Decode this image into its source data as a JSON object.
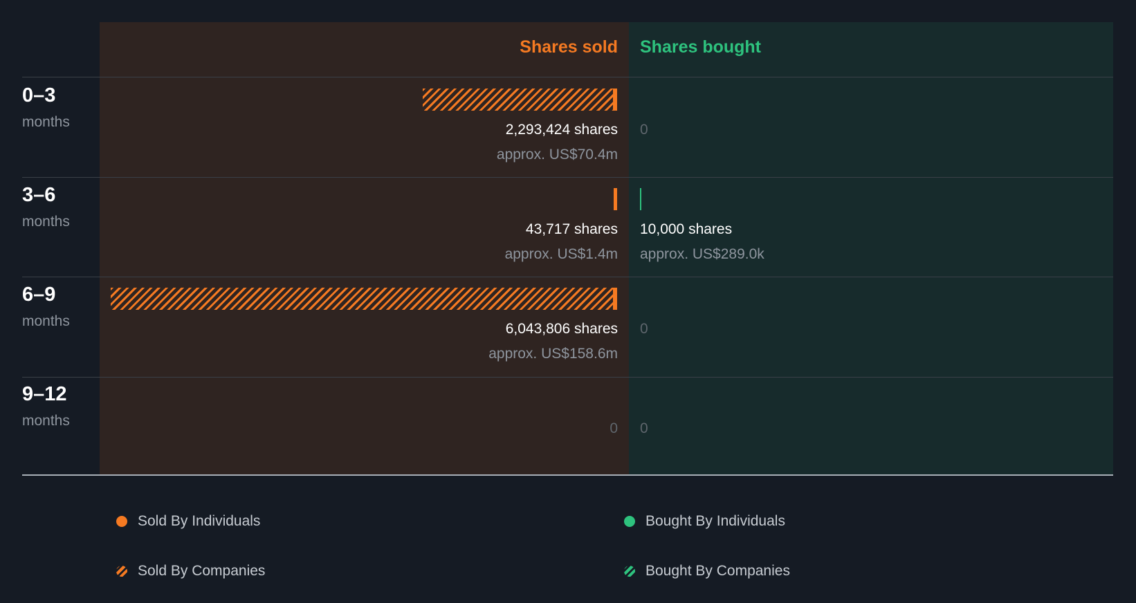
{
  "chart_data": {
    "type": "bar",
    "headers": {
      "sold": "Shares sold",
      "bought": "Shares bought"
    },
    "rows": [
      {
        "range": "0–3",
        "unit": "months",
        "sold": {
          "shares": 2293424,
          "shares_label": "2,293,424 shares",
          "value_label": "approx. US$70.4m",
          "by_companies": 2293424
        },
        "bought": {
          "shares": 0,
          "shares_label": "0",
          "value_label": ""
        }
      },
      {
        "range": "3–6",
        "unit": "months",
        "sold": {
          "shares": 43717,
          "shares_label": "43,717 shares",
          "value_label": "approx. US$1.4m",
          "by_companies": 0
        },
        "bought": {
          "shares": 10000,
          "shares_label": "10,000 shares",
          "value_label": "approx. US$289.0k"
        }
      },
      {
        "range": "6–9",
        "unit": "months",
        "sold": {
          "shares": 6043806,
          "shares_label": "6,043,806 shares",
          "value_label": "approx. US$158.6m",
          "by_companies": 6043806
        },
        "bought": {
          "shares": 0,
          "shares_label": "0",
          "value_label": ""
        }
      },
      {
        "range": "9–12",
        "unit": "months",
        "sold": {
          "shares": 0,
          "shares_label": "0",
          "value_label": "",
          "by_companies": 0
        },
        "bought": {
          "shares": 0,
          "shares_label": "0",
          "value_label": ""
        }
      }
    ],
    "legend": [
      {
        "key": "sold-individuals",
        "label": "Sold By Individuals"
      },
      {
        "key": "bought-individuals",
        "label": "Bought By Individuals"
      },
      {
        "key": "sold-companies",
        "label": "Sold By Companies"
      },
      {
        "key": "bought-companies",
        "label": "Bought By Companies"
      }
    ],
    "colors": {
      "sold": "#f57a22",
      "bought": "#2ec27e"
    }
  }
}
